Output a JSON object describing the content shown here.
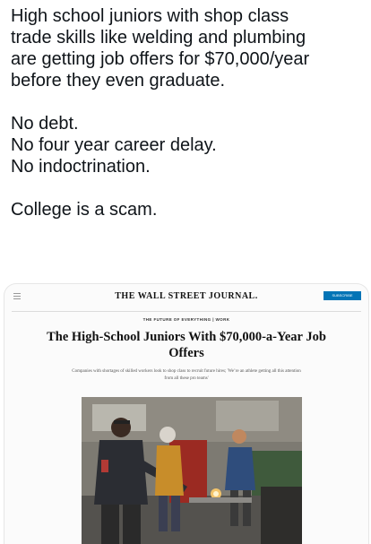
{
  "post": {
    "line1": "High school juniors with shop class",
    "line2": "trade skills like welding and plumbing",
    "line3": "are getting job offers for $70,000/year",
    "line4": "before they even graduate.",
    "line5": "No debt.",
    "line6": "No four year career delay.",
    "line7": "No indoctrination.",
    "line8": "College is a scam."
  },
  "article": {
    "masthead": "THE WALL STREET JOURNAL.",
    "subscribe_label": "SUBSCRIBE",
    "section": "THE FUTURE OF EVERYTHING | WORK",
    "headline": "The High-School Juniors With $70,000-a-Year Job Offers",
    "dek": "Companies with shortages of skilled workers look to shop class to recruit future hires; 'We’re an athlete getting all this attention from all these pro teams'"
  },
  "colors": {
    "text": "#0f1419",
    "subscribe_bg": "#0274b6"
  },
  "icons": [
    "menu-icon"
  ]
}
